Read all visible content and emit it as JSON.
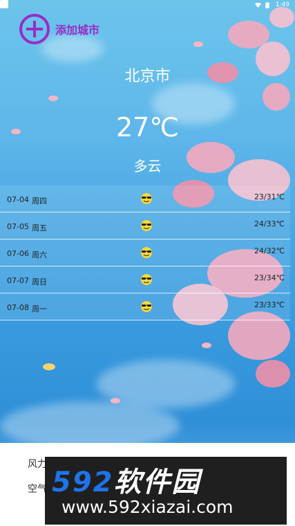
{
  "status_bar": {
    "time": "1:49"
  },
  "header": {
    "add_city_label": "添加城市"
  },
  "current": {
    "city": "北京市",
    "temperature": "27℃",
    "condition": "多云"
  },
  "forecast": [
    {
      "date": "07-04",
      "weekday": "周四",
      "icon": "sun-with-sunglasses-icon",
      "range": "23/31℃"
    },
    {
      "date": "07-05",
      "weekday": "周五",
      "icon": "sun-with-sunglasses-icon",
      "range": "24/33℃"
    },
    {
      "date": "07-06",
      "weekday": "周六",
      "icon": "sun-with-sunglasses-icon",
      "range": "24/32℃"
    },
    {
      "date": "07-07",
      "weekday": "周日",
      "icon": "sun-with-sunglasses-icon",
      "range": "23/34℃"
    },
    {
      "date": "07-08",
      "weekday": "周一",
      "icon": "sun-with-sunglasses-icon",
      "range": "23/33℃"
    }
  ],
  "details": {
    "row1": "风力",
    "row2": "空气"
  },
  "watermark": {
    "brand_number": "592",
    "brand_text": "软件园",
    "url": "www.592xiazai.com"
  },
  "colors": {
    "accent": "#9b2bc4",
    "watermark_blue": "#1f73e8"
  }
}
